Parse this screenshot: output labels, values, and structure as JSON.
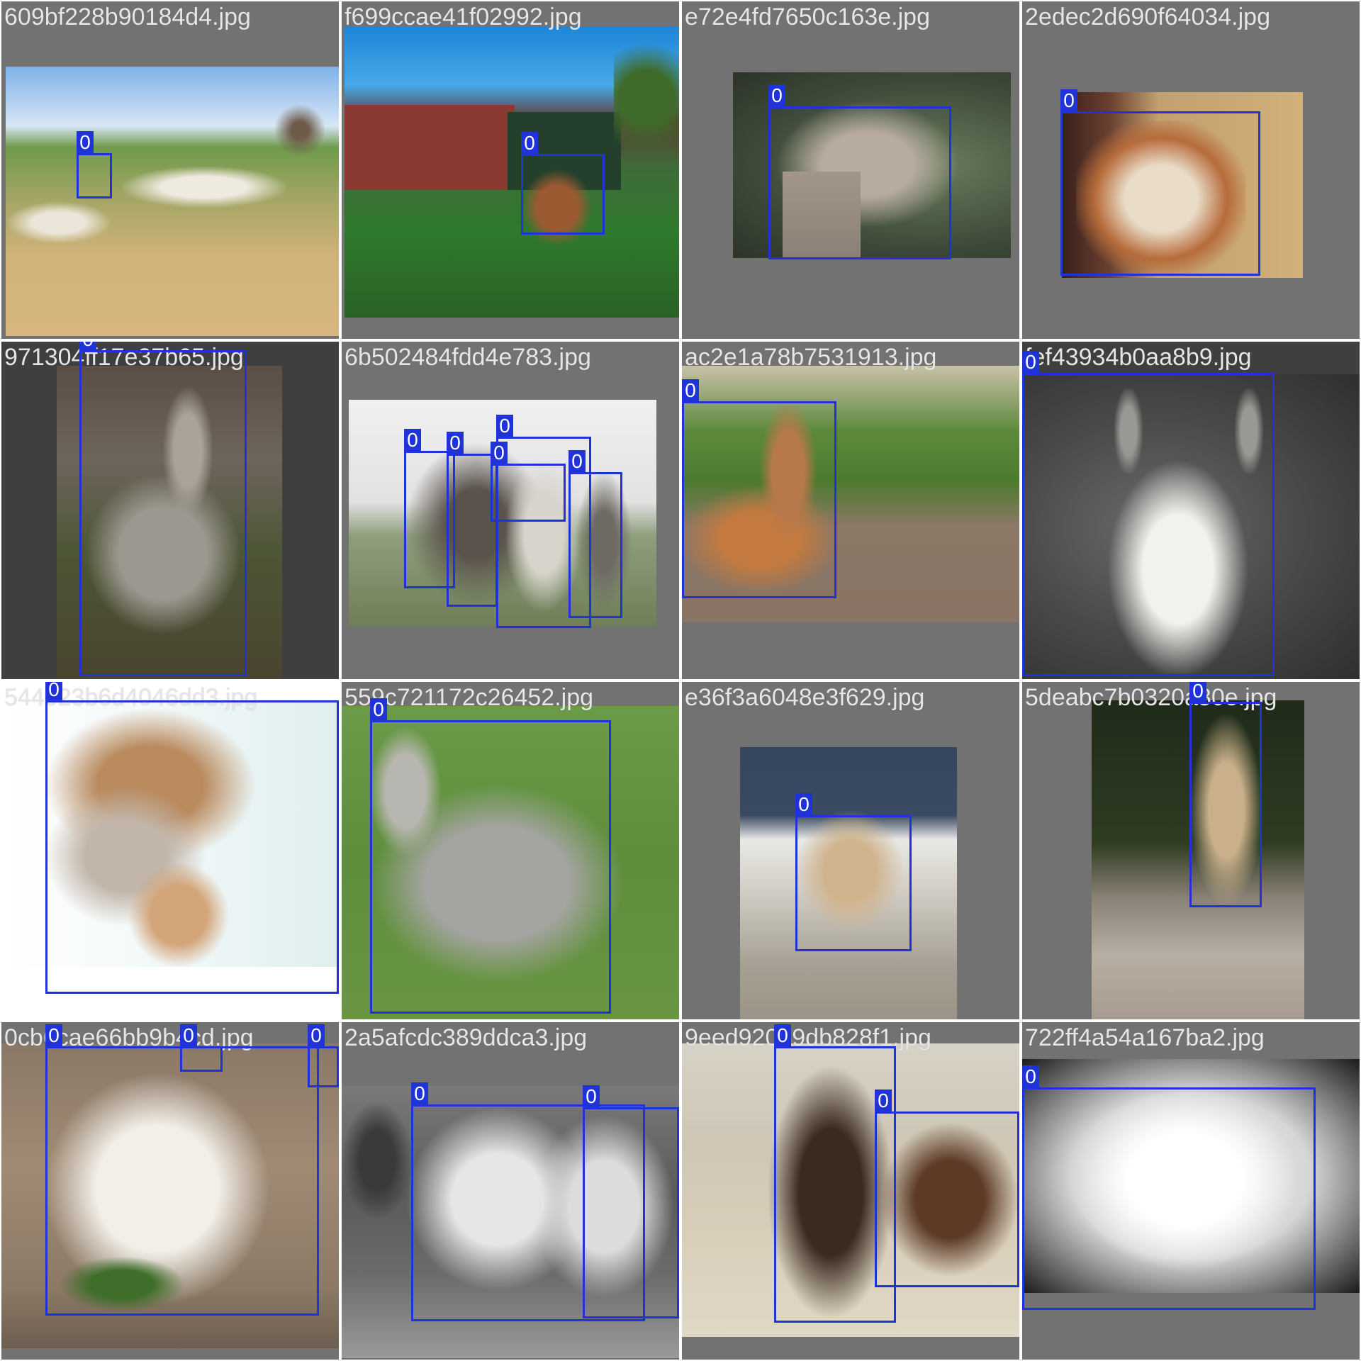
{
  "grid": {
    "columns": 4,
    "rows": 4
  },
  "colors": {
    "tile_background": "#727272",
    "box": "#1f33d9",
    "box_label_text": "#ffffff",
    "filename_text": "#e6e6e6"
  },
  "tiles": [
    {
      "filename": "609bf228b90184d4.jpg",
      "content": "herd-of-sheep-with-one-llama-on-hillside",
      "box_labels": [
        "0"
      ]
    },
    {
      "filename": "f699ccae41f02992.jpg",
      "content": "brown-llama-near-red-barn-and-fence",
      "box_labels": [
        "0"
      ]
    },
    {
      "filename": "e72e4fd7650c163e.jpg",
      "content": "camel-head-profile",
      "box_labels": [
        "0"
      ]
    },
    {
      "filename": "2edec2d690f64034.jpg",
      "content": "brown-and-white-llama-with-halter-in-hay",
      "box_labels": [
        "0"
      ]
    },
    {
      "filename": "971304ff17e37b65.jpg",
      "content": "gray-woolly-alpaca-standing",
      "box_labels": [
        "0"
      ]
    },
    {
      "filename": "6b502484fdd4e783.jpg",
      "content": "group-of-alpacas-in-field",
      "box_labels": [
        "0",
        "0",
        "0",
        "0",
        "0"
      ]
    },
    {
      "filename": "ac2e1a78b7531913.jpg",
      "content": "vicuna-lying-down-by-fence",
      "box_labels": [
        "0"
      ]
    },
    {
      "filename": "fef43934b0aa8b9.jpg",
      "content": "llama-head-with-ear-tag",
      "box_labels": [
        "0"
      ]
    },
    {
      "filename": "544023b6d4046dd3.jpg",
      "content": "fluffy-alpaca-face-closeup",
      "box_labels": [
        "0"
      ]
    },
    {
      "filename": "559c721172c26452.jpg",
      "content": "gray-alpaca-on-grass",
      "box_labels": [
        "0"
      ]
    },
    {
      "filename": "e36f3a6048e3f629.jpg",
      "content": "vicunas-on-sandy-ground",
      "box_labels": [
        "0"
      ]
    },
    {
      "filename": "5deabc7b0320a80e.jpg",
      "content": "vicuna-standing-on-rocks",
      "box_labels": [
        "0"
      ]
    },
    {
      "filename": "0cb6cae66bb9b4cd.jpg",
      "content": "white-alpaca-eating-leaves",
      "box_labels": [
        "0",
        "0",
        "0"
      ]
    },
    {
      "filename": "2a5afcdc389ddca3.jpg",
      "content": "pack-llamas-black-and-white",
      "box_labels": [
        "0",
        "0"
      ]
    },
    {
      "filename": "9eed92049db828f1.jpg",
      "content": "two-dark-llamas-under-trees",
      "box_labels": [
        "0",
        "0"
      ]
    },
    {
      "filename": "722ff4a54a167ba2.jpg",
      "content": "llama-head-black-and-white",
      "box_labels": [
        "0"
      ]
    }
  ]
}
